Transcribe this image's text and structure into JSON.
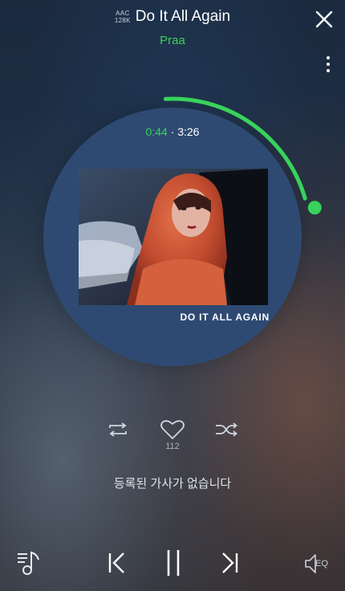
{
  "header": {
    "quality_line1": "AAC",
    "quality_line2": "128K",
    "title": "Do It All Again",
    "artist": "Praa"
  },
  "player": {
    "elapsed": "0:44",
    "separator": "·",
    "duration": "3:26",
    "progress_fraction": 0.213,
    "album_caption": "DO IT ALL AGAIN",
    "like_count": "112",
    "lyrics_message": "등록된 가사가 없습니다"
  },
  "controls": {
    "eq_label": "EQ"
  },
  "icons": [
    "close-icon",
    "more-vertical-icon",
    "repeat-icon",
    "heart-icon",
    "shuffle-icon",
    "playlist-icon",
    "previous-icon",
    "pause-icon",
    "next-icon",
    "eq-speaker-icon"
  ],
  "colors": {
    "accent": "#38d35a",
    "disc": "#2e4a72"
  }
}
